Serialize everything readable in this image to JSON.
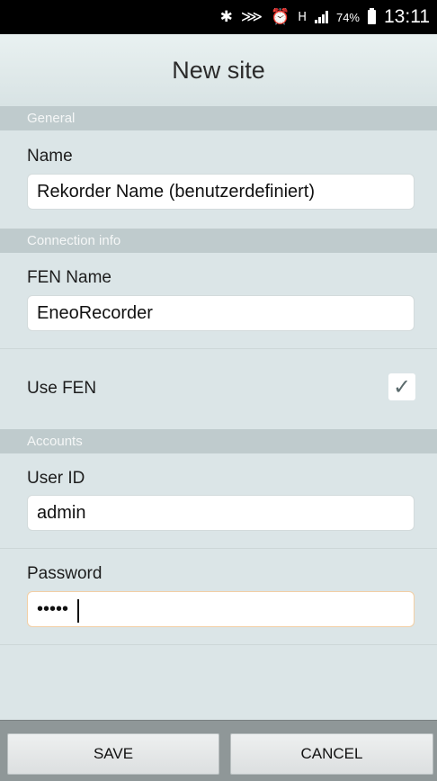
{
  "status_bar": {
    "icons": [
      "bluetooth-icon",
      "mute-icon",
      "alarm-icon",
      "hspa-icon",
      "signal-icon"
    ],
    "bluetooth": "✱",
    "mute": "⋙",
    "alarm": "⏰",
    "network": "H",
    "battery_percent": "74%",
    "time": "13:11"
  },
  "header": {
    "title": "New site"
  },
  "sections": {
    "general": "General",
    "connection": "Connection info",
    "accounts": "Accounts"
  },
  "fields": {
    "name": {
      "label": "Name",
      "value": "Rekorder Name (benutzerdefiniert)"
    },
    "fen_name": {
      "label": "FEN Name",
      "value": "EneoRecorder"
    },
    "use_fen": {
      "label": "Use FEN",
      "checked": true,
      "check_glyph": "✓"
    },
    "user_id": {
      "label": "User ID",
      "value": "admin"
    },
    "password": {
      "label": "Password",
      "value": "•••••"
    }
  },
  "buttons": {
    "save": "SAVE",
    "cancel": "CANCEL"
  },
  "colors": {
    "check": "#5a6a6c",
    "background": "#dbe5e7",
    "section": "#bfcbcd"
  }
}
